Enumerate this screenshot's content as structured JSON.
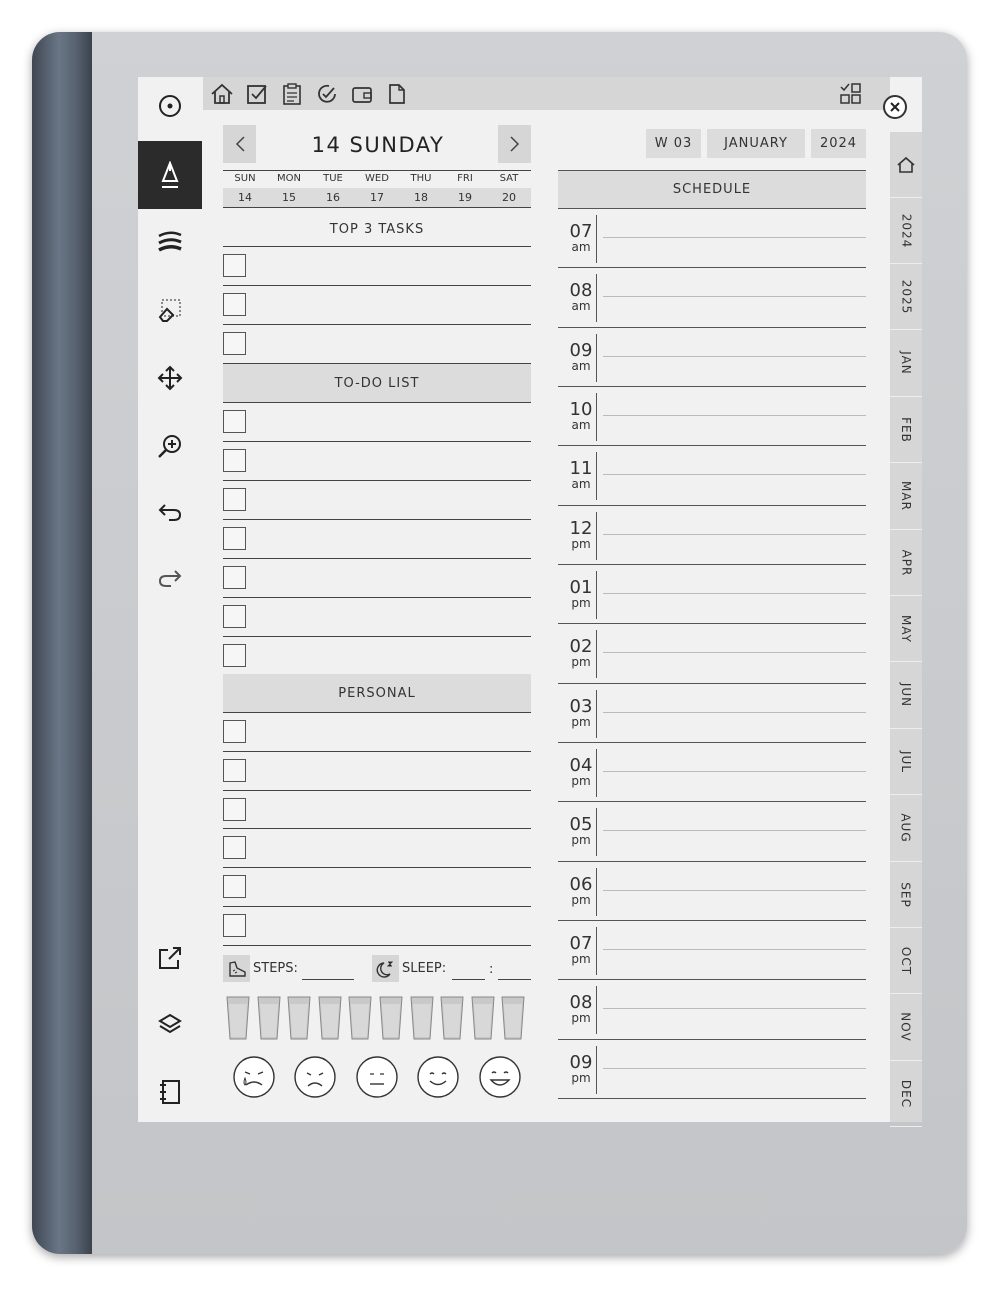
{
  "day_title": "14 SUNDAY",
  "week": "W 03",
  "month": "JANUARY",
  "year": "2024",
  "week_strip": {
    "days": [
      "SUN",
      "MON",
      "TUE",
      "WED",
      "THU",
      "FRI",
      "SAT"
    ],
    "dates": [
      "14",
      "15",
      "16",
      "17",
      "18",
      "19",
      "20"
    ]
  },
  "sections": {
    "top3": "TOP 3 TASKS",
    "todo": "TO-DO LIST",
    "personal": "PERSONAL",
    "schedule": "SCHEDULE"
  },
  "trackers": {
    "steps_label": "STEPS:",
    "sleep_label": "SLEEP:",
    "sleep_sep": ":"
  },
  "schedule_hours": [
    {
      "h": "07",
      "ap": "am"
    },
    {
      "h": "08",
      "ap": "am"
    },
    {
      "h": "09",
      "ap": "am"
    },
    {
      "h": "10",
      "ap": "am"
    },
    {
      "h": "11",
      "ap": "am"
    },
    {
      "h": "12",
      "ap": "pm"
    },
    {
      "h": "01",
      "ap": "pm"
    },
    {
      "h": "02",
      "ap": "pm"
    },
    {
      "h": "03",
      "ap": "pm"
    },
    {
      "h": "04",
      "ap": "pm"
    },
    {
      "h": "05",
      "ap": "pm"
    },
    {
      "h": "06",
      "ap": "pm"
    },
    {
      "h": "07",
      "ap": "pm"
    },
    {
      "h": "08",
      "ap": "pm"
    },
    {
      "h": "09",
      "ap": "pm"
    }
  ],
  "side_tabs": [
    "2024",
    "2025",
    "JAN",
    "FEB",
    "MAR",
    "APR",
    "MAY",
    "JUN",
    "JUL",
    "AUG",
    "SEP",
    "OCT",
    "NOV",
    "DEC"
  ],
  "top_nav_icons": [
    "home-icon",
    "checkbox-icon",
    "clipboard-icon",
    "habit-icon",
    "wallet-icon",
    "document-icon"
  ],
  "toolbar_icons": [
    "menu-circle-icon",
    "pen-icon",
    "stroke-width-icon",
    "eraser-icon",
    "move-icon",
    "zoom-icon",
    "undo-icon",
    "redo-icon",
    "share-icon",
    "layers-icon",
    "notebook-icon"
  ],
  "water_cups": 10,
  "moods": [
    "crying-face-icon",
    "sad-face-icon",
    "neutral-face-icon",
    "content-face-icon",
    "happy-face-icon"
  ],
  "colors": {
    "screen": "#f1f1f1",
    "header_gray": "#dcdcdc",
    "active_tool": "#2b2b2b",
    "spine": "#5b6675"
  }
}
